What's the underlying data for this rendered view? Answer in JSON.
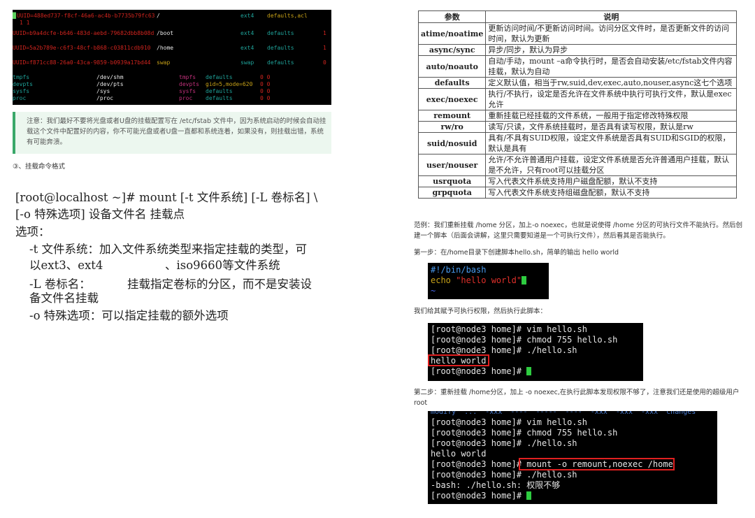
{
  "fstab": {
    "rows": [
      {
        "uuid": "UUID=488ed737-f8cf-46a6-ac4b-b7735b79fc63",
        "mount": "/",
        "fs": "ext4",
        "opts": "defaults,acl",
        "n": "1 1"
      },
      {
        "uuid": "UUID=b9a4dcfe-b646-483d-aebd-79682dbb8b08d",
        "mount": "/boot",
        "fs": "ext4",
        "opts": "defaults",
        "n": "1"
      },
      {
        "uuid": "UUID=5a2b789e-c6f3-48cf-b868-c03811cdb910",
        "mount": "/home",
        "fs": "ext4",
        "opts": "defaults",
        "n": "1"
      },
      {
        "uuid": "UUID=f871cc88-26a0-43ca-9859-b0939a17bd44",
        "mount": "swap",
        "fs": "swap",
        "opts": "defaults",
        "n": "0"
      }
    ],
    "sys": [
      {
        "dev": "tmpfs",
        "mount": "/dev/shm",
        "fs": "tmpfs",
        "opts": "defaults",
        "n": "0 0"
      },
      {
        "dev": "devpts",
        "mount": "/dev/pts",
        "fs": "devpts",
        "opts": "gid=5,mode=620",
        "n": "0 0"
      },
      {
        "dev": "sysfs",
        "mount": "/sys",
        "fs": "sysfs",
        "opts": "defaults",
        "n": "0 0"
      },
      {
        "dev": "proc",
        "mount": "/proc",
        "fs": "proc",
        "opts": "defaults",
        "n": "0 0"
      }
    ]
  },
  "note": "注意：我们最好不要将光盘或者U盘的挂载配置写在 /etc/fstab 文件中，因为系统启动的时候会自动挂载这个文件中配置好的内容，你不可能光盘或者U盘一直都和系统连着，如果没有，则挂载出错，系统有可能奔溃。",
  "section3": "③、挂载命令格式",
  "slide": {
    "line1": "[root@localhost ~]# mount [-t 文件系统] [-L 卷标名] \\",
    "line2": "[-o 特殊选项]   设备文件名 挂载点",
    "line3": "选项：",
    "opt_t1": "-t 文件系统：加入文件系统类型来指定挂载的类型，可",
    "opt_t2a": "以ext3、ext4",
    "opt_t2b": "、iso9660等文件系统",
    "opt_L1a": "-L 卷标名：",
    "opt_L1b": "挂载指定卷标的分区，而不是安装设",
    "opt_L2": "备文件名挂载",
    "opt_o": "-o 特殊选项：可以指定挂载的额外选项"
  },
  "table": {
    "headers": [
      "参数",
      "说明"
    ],
    "rows": [
      {
        "k": "atime/noatime",
        "v": "更新访问时间/不更新访问时间。访问分区文件时，是否更新文件的访问时间，默认为更新"
      },
      {
        "k": "async/sync",
        "v": "异步/同步，默认为异步"
      },
      {
        "k": "auto/noauto",
        "v": "自动/手动，mount –a命令执行时，是否会自动安装/etc/fstab文件内容挂载，默认为自动"
      },
      {
        "k": "defaults",
        "v": "定义默认值，相当于rw,suid,dev,exec,auto,nouser,async这七个选项"
      },
      {
        "k": "exec/noexec",
        "v": "执行/不执行，设定是否允许在文件系统中执行可执行文件，默认是exec允许"
      },
      {
        "k": "remount",
        "v": "重新挂载已经挂载的文件系统，一般用于指定修改特殊权限"
      },
      {
        "k": "rw/ro",
        "v": "读写/只读，文件系统挂载时，是否具有读写权限，默认是rw"
      },
      {
        "k": "suid/nosuid",
        "v": "具有/不具有SUID权限，设定文件系统是否具有SUID和SGID的权限，默认是具有"
      },
      {
        "k": "user/nouser",
        "v": "允许/不允许普通用户挂载，设定文件系统是否允许普通用户挂载，默认是不允许，只有root可以挂载分区"
      },
      {
        "k": "usrquota",
        "v": "写入代表文件系统支持用户磁盘配额，默认不支持"
      },
      {
        "k": "grpquota",
        "v": "写入代表文件系统支持组磁盘配额，默认不支持"
      }
    ]
  },
  "example": "范例：我们重新挂载 /home 分区，加上-o noexec，也就是说使得 /home 分区的可执行文件不能执行。然后创建一个脚本（后面会讲解，这里只需要知道是一个可执行文件），然后看其是否能执行。",
  "step1": "第一步：在/home目录下创建脚本hello.sh，简单的输出 hello world",
  "script": {
    "l1": "#!/bin/bash",
    "l2a": "echo ",
    "l2b": "\"hello world\"",
    "l3": "~"
  },
  "give_exec": "我们给其赋予可执行权限，然后执行此脚本：",
  "term1": [
    "[root@node3 home]# vim hello.sh",
    "[root@node3 home]# chmod 755 hello.sh",
    "[root@node3 home]# ./hello.sh",
    "hello world",
    "[root@node3 home]# "
  ],
  "step2": "第二步：重新挂载 /home分区，加上 -o noexec,在执行此脚本发现权限不够了，注意我们还是使用的超级用户root",
  "term2": {
    "top": "modify  ...  -xxx  ----  -----  ----  -xxx  -xxx  -xxx  changes",
    "lines": [
      "[root@node3 home]# vim hello.sh",
      "[root@node3 home]# chmod 755 hello.sh",
      "[root@node3 home]# ./hello.sh",
      "hello world",
      "[root@node3 home]# ",
      "[root@node3 home]# ./hello.sh",
      "-bash: ./hello.sh: 权限不够",
      "[root@node3 home]# "
    ],
    "cmd": "mount -o remount,noexec /home"
  }
}
